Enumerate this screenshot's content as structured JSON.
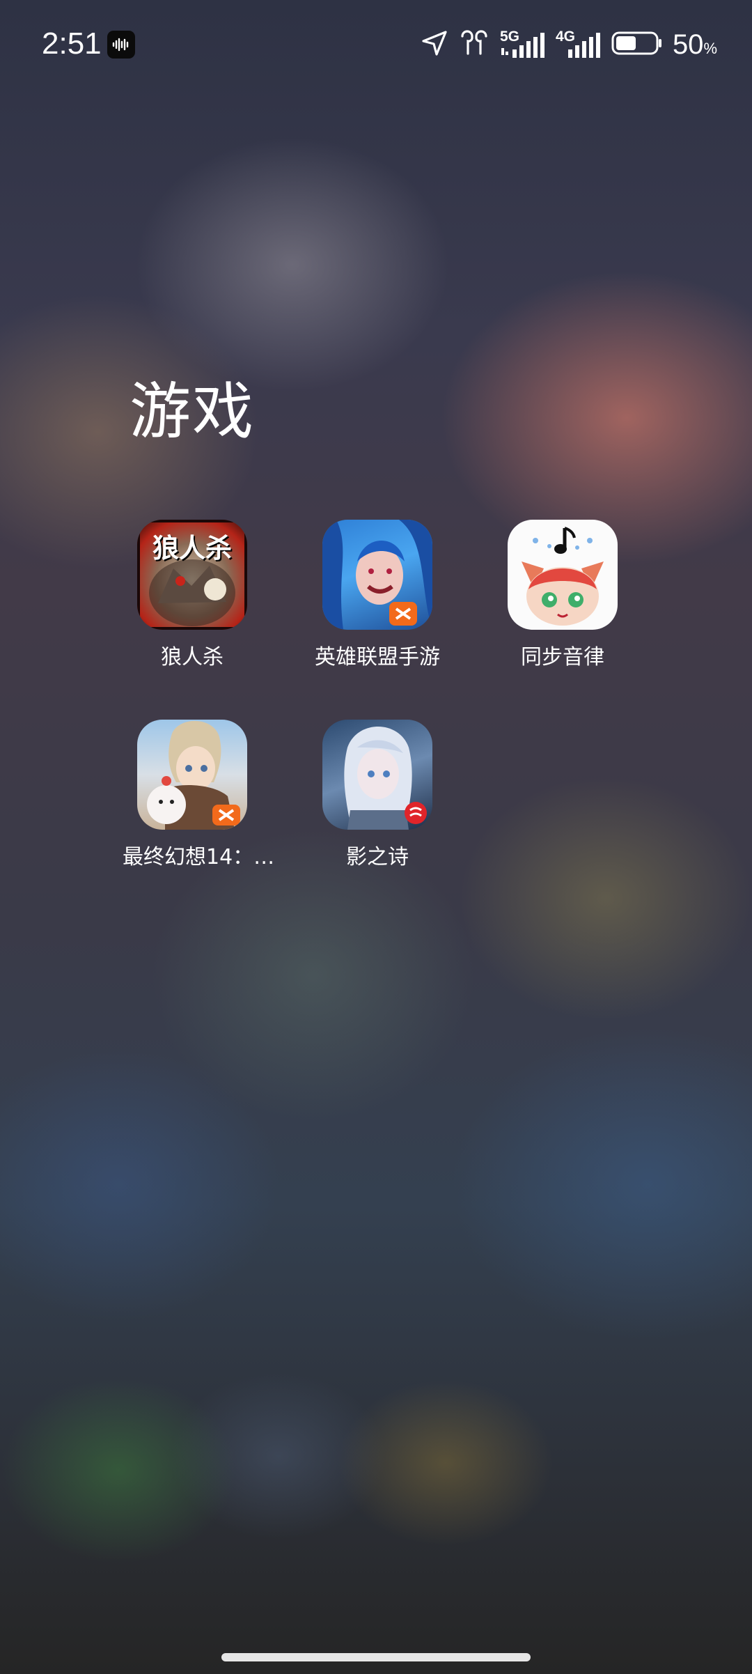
{
  "status_bar": {
    "time": "2:51",
    "net1": "5G",
    "net2": "4G",
    "battery_value": "50",
    "battery_unit": "%",
    "battery_level": 0.5,
    "icons": [
      "soundwave-badge-icon",
      "location-arrow-icon",
      "earbuds-icon",
      "signal-5g-icon",
      "signal-4g-icon",
      "battery-icon"
    ]
  },
  "folder": {
    "title": "游戏",
    "apps": [
      {
        "label": "狼人杀",
        "icon": "werewolf-game-icon",
        "icon_text": "狼人杀"
      },
      {
        "label": "英雄联盟手游",
        "icon": "league-of-legends-mobile-icon"
      },
      {
        "label": "同步音律",
        "icon": "synchronous-rhythm-icon"
      },
      {
        "label": "最终幻想14：…",
        "icon": "final-fantasy-14-icon"
      },
      {
        "label": "影之诗",
        "icon": "shadowverse-icon"
      }
    ]
  },
  "colors": {
    "text": "#ffffff",
    "home_indicator": "#e6e6e6"
  }
}
